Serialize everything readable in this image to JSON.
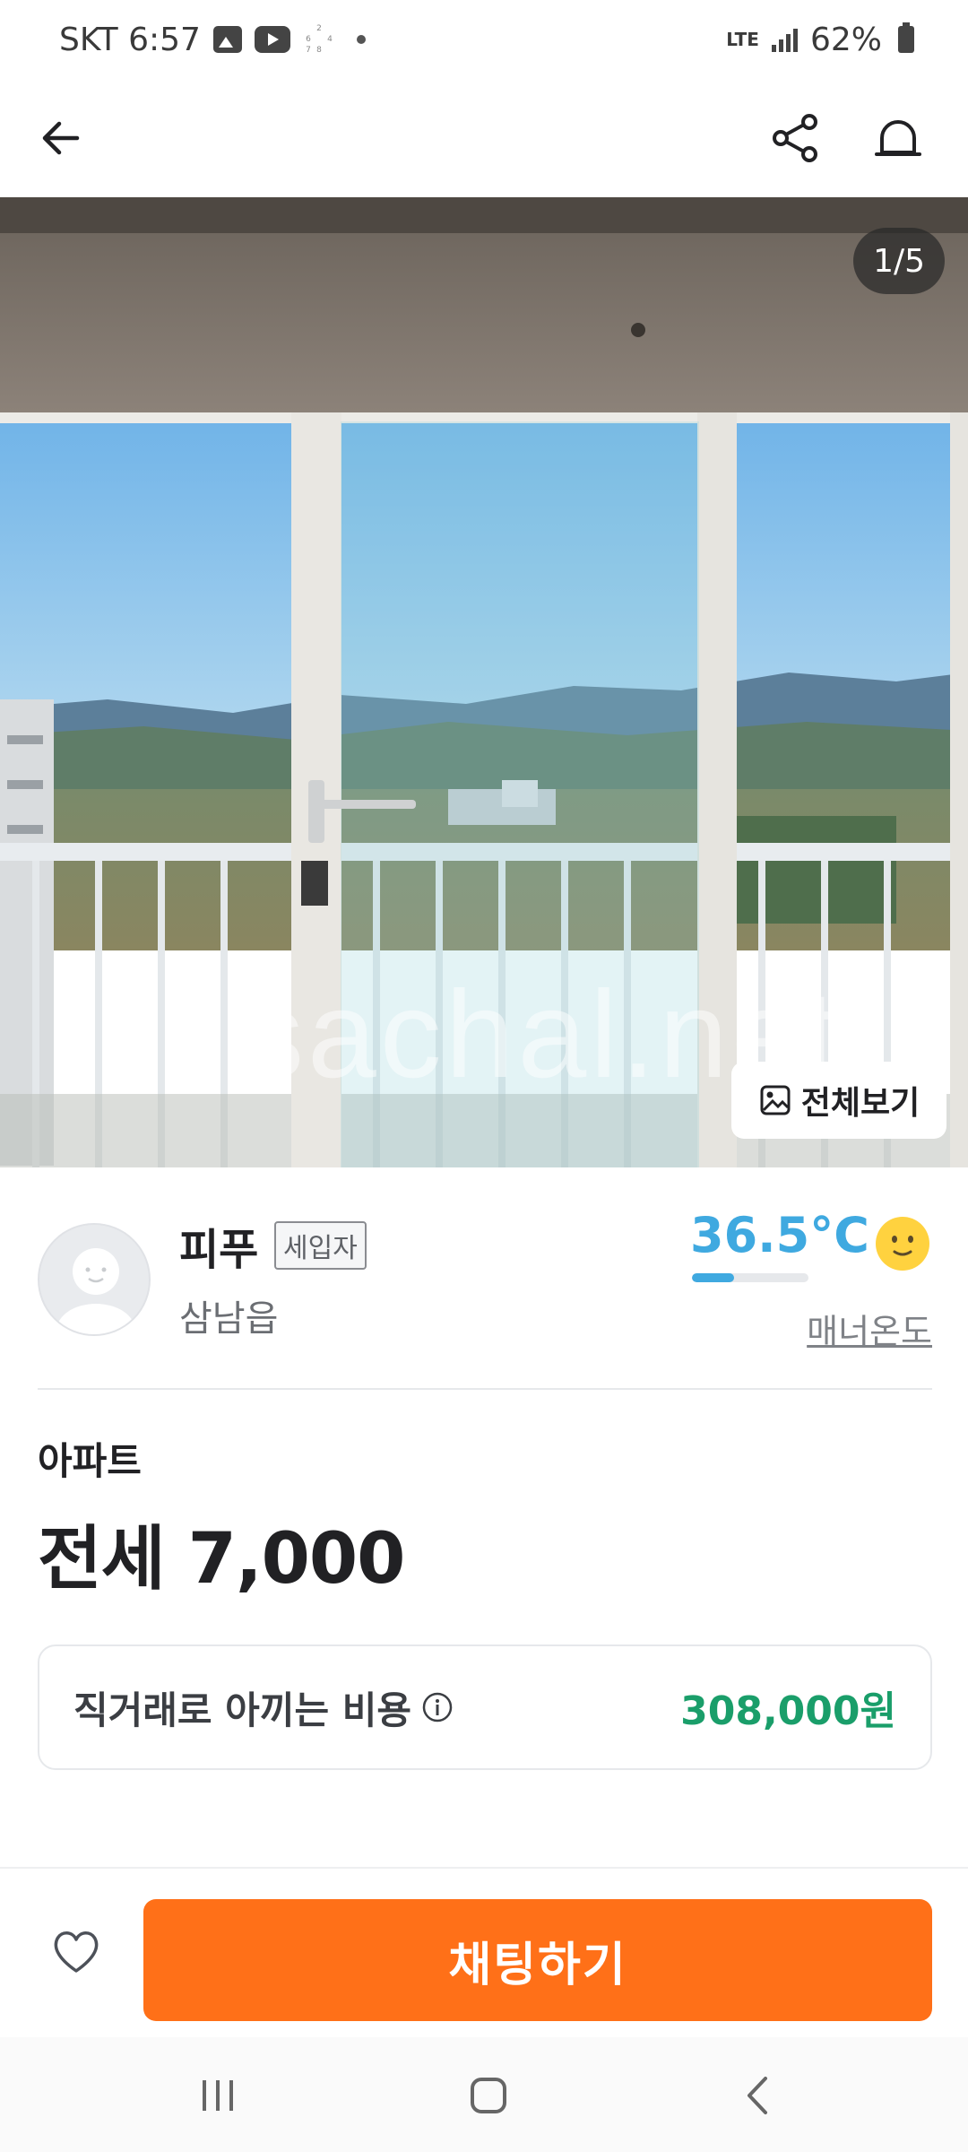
{
  "status_bar": {
    "carrier_time": "SKT 6:57",
    "network": "LTE",
    "battery": "62%"
  },
  "photo": {
    "indicator": "1/5",
    "watermark": "sachal.net",
    "view_all_label": "전체보기"
  },
  "seller": {
    "nickname": "피푸",
    "role_badge": "세입자",
    "location": "삼남읍",
    "temperature": "36.5°C",
    "temperature_level": 0.365,
    "manner_label": "매너온도"
  },
  "listing": {
    "category": "아파트",
    "price": "전세 7,000"
  },
  "savings": {
    "label": "직거래로 아끼는 비용",
    "amount": "308,000원"
  },
  "actions": {
    "chat_label": "채팅하기"
  },
  "colors": {
    "accent_orange": "#ff7018",
    "temperature_blue": "#3fa9e0",
    "savings_green": "#1a9e6a"
  }
}
